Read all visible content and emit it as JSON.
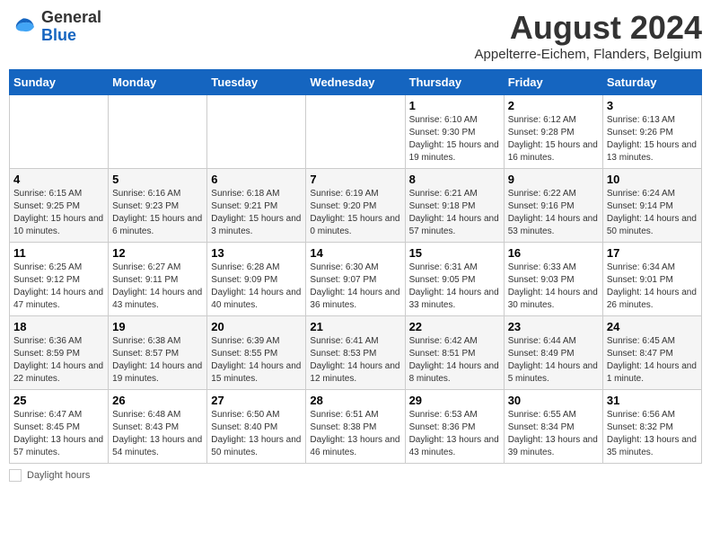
{
  "logo": {
    "general": "General",
    "blue": "Blue"
  },
  "header": {
    "month_year": "August 2024",
    "location": "Appelterre-Eichem, Flanders, Belgium"
  },
  "days_of_week": [
    "Sunday",
    "Monday",
    "Tuesday",
    "Wednesday",
    "Thursday",
    "Friday",
    "Saturday"
  ],
  "weeks": [
    [
      {
        "day": null
      },
      {
        "day": null
      },
      {
        "day": null
      },
      {
        "day": null
      },
      {
        "day": 1,
        "sunrise": "6:10 AM",
        "sunset": "9:30 PM",
        "daylight": "15 hours and 19 minutes."
      },
      {
        "day": 2,
        "sunrise": "6:12 AM",
        "sunset": "9:28 PM",
        "daylight": "15 hours and 16 minutes."
      },
      {
        "day": 3,
        "sunrise": "6:13 AM",
        "sunset": "9:26 PM",
        "daylight": "15 hours and 13 minutes."
      }
    ],
    [
      {
        "day": 4,
        "sunrise": "6:15 AM",
        "sunset": "9:25 PM",
        "daylight": "15 hours and 10 minutes."
      },
      {
        "day": 5,
        "sunrise": "6:16 AM",
        "sunset": "9:23 PM",
        "daylight": "15 hours and 6 minutes."
      },
      {
        "day": 6,
        "sunrise": "6:18 AM",
        "sunset": "9:21 PM",
        "daylight": "15 hours and 3 minutes."
      },
      {
        "day": 7,
        "sunrise": "6:19 AM",
        "sunset": "9:20 PM",
        "daylight": "15 hours and 0 minutes."
      },
      {
        "day": 8,
        "sunrise": "6:21 AM",
        "sunset": "9:18 PM",
        "daylight": "14 hours and 57 minutes."
      },
      {
        "day": 9,
        "sunrise": "6:22 AM",
        "sunset": "9:16 PM",
        "daylight": "14 hours and 53 minutes."
      },
      {
        "day": 10,
        "sunrise": "6:24 AM",
        "sunset": "9:14 PM",
        "daylight": "14 hours and 50 minutes."
      }
    ],
    [
      {
        "day": 11,
        "sunrise": "6:25 AM",
        "sunset": "9:12 PM",
        "daylight": "14 hours and 47 minutes."
      },
      {
        "day": 12,
        "sunrise": "6:27 AM",
        "sunset": "9:11 PM",
        "daylight": "14 hours and 43 minutes."
      },
      {
        "day": 13,
        "sunrise": "6:28 AM",
        "sunset": "9:09 PM",
        "daylight": "14 hours and 40 minutes."
      },
      {
        "day": 14,
        "sunrise": "6:30 AM",
        "sunset": "9:07 PM",
        "daylight": "14 hours and 36 minutes."
      },
      {
        "day": 15,
        "sunrise": "6:31 AM",
        "sunset": "9:05 PM",
        "daylight": "14 hours and 33 minutes."
      },
      {
        "day": 16,
        "sunrise": "6:33 AM",
        "sunset": "9:03 PM",
        "daylight": "14 hours and 30 minutes."
      },
      {
        "day": 17,
        "sunrise": "6:34 AM",
        "sunset": "9:01 PM",
        "daylight": "14 hours and 26 minutes."
      }
    ],
    [
      {
        "day": 18,
        "sunrise": "6:36 AM",
        "sunset": "8:59 PM",
        "daylight": "14 hours and 22 minutes."
      },
      {
        "day": 19,
        "sunrise": "6:38 AM",
        "sunset": "8:57 PM",
        "daylight": "14 hours and 19 minutes."
      },
      {
        "day": 20,
        "sunrise": "6:39 AM",
        "sunset": "8:55 PM",
        "daylight": "14 hours and 15 minutes."
      },
      {
        "day": 21,
        "sunrise": "6:41 AM",
        "sunset": "8:53 PM",
        "daylight": "14 hours and 12 minutes."
      },
      {
        "day": 22,
        "sunrise": "6:42 AM",
        "sunset": "8:51 PM",
        "daylight": "14 hours and 8 minutes."
      },
      {
        "day": 23,
        "sunrise": "6:44 AM",
        "sunset": "8:49 PM",
        "daylight": "14 hours and 5 minutes."
      },
      {
        "day": 24,
        "sunrise": "6:45 AM",
        "sunset": "8:47 PM",
        "daylight": "14 hours and 1 minute."
      }
    ],
    [
      {
        "day": 25,
        "sunrise": "6:47 AM",
        "sunset": "8:45 PM",
        "daylight": "13 hours and 57 minutes."
      },
      {
        "day": 26,
        "sunrise": "6:48 AM",
        "sunset": "8:43 PM",
        "daylight": "13 hours and 54 minutes."
      },
      {
        "day": 27,
        "sunrise": "6:50 AM",
        "sunset": "8:40 PM",
        "daylight": "13 hours and 50 minutes."
      },
      {
        "day": 28,
        "sunrise": "6:51 AM",
        "sunset": "8:38 PM",
        "daylight": "13 hours and 46 minutes."
      },
      {
        "day": 29,
        "sunrise": "6:53 AM",
        "sunset": "8:36 PM",
        "daylight": "13 hours and 43 minutes."
      },
      {
        "day": 30,
        "sunrise": "6:55 AM",
        "sunset": "8:34 PM",
        "daylight": "13 hours and 39 minutes."
      },
      {
        "day": 31,
        "sunrise": "6:56 AM",
        "sunset": "8:32 PM",
        "daylight": "13 hours and 35 minutes."
      }
    ]
  ],
  "footer": {
    "daylight_label": "Daylight hours"
  }
}
